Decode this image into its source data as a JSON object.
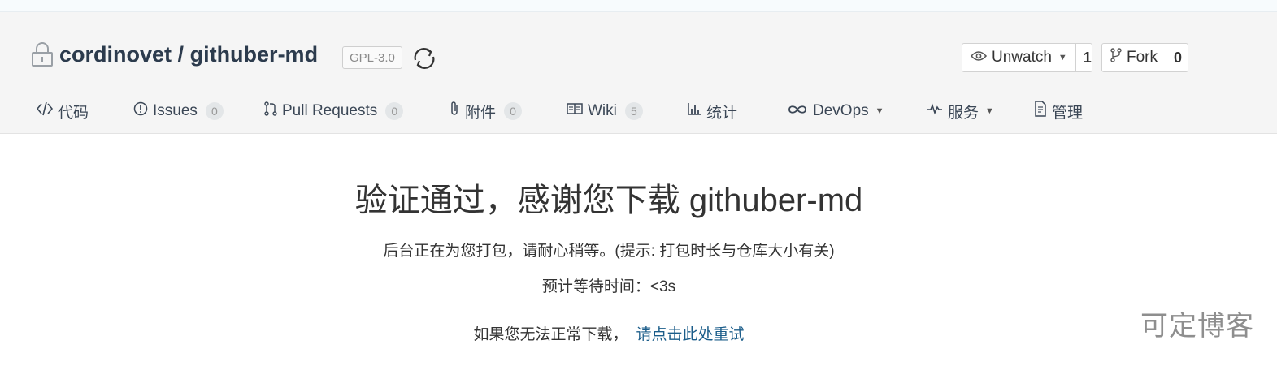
{
  "repo": {
    "owner": "cordinovet",
    "separator": "/",
    "name": "githuber-md",
    "license": "GPL-3.0"
  },
  "actions": {
    "watch_label": "Unwatch",
    "watch_count": "1",
    "fork_label": "Fork",
    "fork_count": "0"
  },
  "nav": {
    "code": "代码",
    "issues": "Issues",
    "issues_count": "0",
    "pulls": "Pull Requests",
    "pulls_count": "0",
    "attachments": "附件",
    "attachments_count": "0",
    "wiki": "Wiki",
    "wiki_count": "5",
    "stats": "统计",
    "devops": "DevOps",
    "services": "服务",
    "manage": "管理"
  },
  "content": {
    "title": "验证通过，感谢您下载 githuber-md",
    "packing": "后台正在为您打包，请耐心稍等。(提示: 打包时长与仓库大小有关)",
    "wait": "预计等待时间：<3s",
    "retry_prefix": "如果您无法正常下载，",
    "retry_link": "请点击此处重试"
  },
  "watermark": "可定博客",
  "icons": [
    "lock-icon",
    "sync-icon",
    "eye-icon",
    "fork-icon",
    "code-icon",
    "issue-icon",
    "pull-request-icon",
    "paperclip-icon",
    "book-icon",
    "bar-chart-icon",
    "infinity-icon",
    "pulse-icon",
    "document-icon",
    "caret-down-icon"
  ],
  "colors": {
    "header_bg": "#f5f5f5",
    "title_text": "#2c3b4d",
    "link": "#1b5d8a",
    "badge_bg": "#e3e6e8"
  }
}
